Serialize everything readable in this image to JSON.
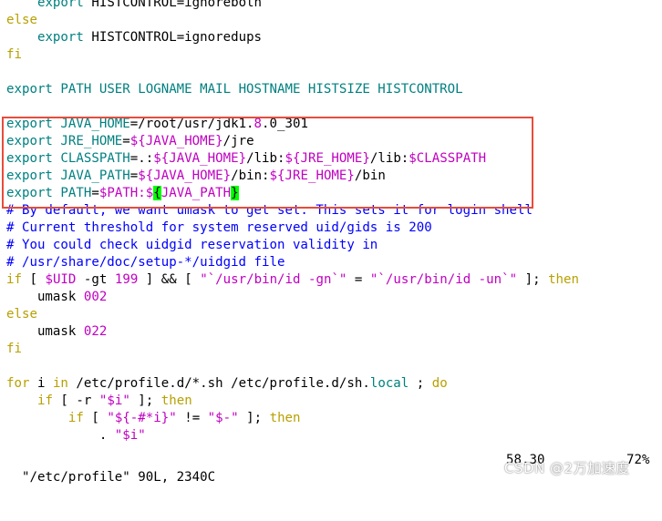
{
  "colors": {
    "keyword": "#b8a000",
    "command": "#008080",
    "variable": "#c000c0",
    "comment": "#0000ff",
    "cursor_bg": "#00ff00",
    "highlight_border": "#e74c3c",
    "background": "#ffffff"
  },
  "editor": {
    "lines": [
      [
        {
          "t": "    ",
          "c": ""
        },
        {
          "t": "export",
          "c": "cmd"
        },
        {
          "t": " HISTCONTROL=ignoreboth",
          "c": ""
        }
      ],
      [
        {
          "t": "else",
          "c": "kw"
        }
      ],
      [
        {
          "t": "    ",
          "c": ""
        },
        {
          "t": "export",
          "c": "cmd"
        },
        {
          "t": " HISTCONTROL=ignoredups",
          "c": ""
        }
      ],
      [
        {
          "t": "fi",
          "c": "kw"
        }
      ],
      [
        {
          "t": "",
          "c": ""
        }
      ],
      [
        {
          "t": "export",
          "c": "cmd"
        },
        {
          "t": " PATH USER LOGNAME MAIL HOSTNAME HISTSIZE HISTCONTROL",
          "c": "cmd"
        }
      ],
      [
        {
          "t": "",
          "c": ""
        }
      ],
      [
        {
          "t": "export",
          "c": "cmd"
        },
        {
          "t": " JAVA_HOME",
          "c": "cmd"
        },
        {
          "t": "=/root/usr/jdk1.",
          "c": ""
        },
        {
          "t": "8",
          "c": "num"
        },
        {
          "t": ".0_301",
          "c": ""
        }
      ],
      [
        {
          "t": "export",
          "c": "cmd"
        },
        {
          "t": " JRE_HOME",
          "c": "cmd"
        },
        {
          "t": "=",
          "c": ""
        },
        {
          "t": "${JAVA_HOME}",
          "c": "var"
        },
        {
          "t": "/jre",
          "c": ""
        }
      ],
      [
        {
          "t": "export",
          "c": "cmd"
        },
        {
          "t": " CLASSPATH",
          "c": "cmd"
        },
        {
          "t": "=.:",
          "c": ""
        },
        {
          "t": "${JAVA_HOME}",
          "c": "var"
        },
        {
          "t": "/lib:",
          "c": ""
        },
        {
          "t": "${JRE_HOME}",
          "c": "var"
        },
        {
          "t": "/lib:",
          "c": ""
        },
        {
          "t": "$CLASSPATH",
          "c": "var"
        }
      ],
      [
        {
          "t": "export",
          "c": "cmd"
        },
        {
          "t": " JAVA_PATH",
          "c": "cmd"
        },
        {
          "t": "=",
          "c": ""
        },
        {
          "t": "${JAVA_HOME}",
          "c": "var"
        },
        {
          "t": "/bin:",
          "c": ""
        },
        {
          "t": "${JRE_HOME}",
          "c": "var"
        },
        {
          "t": "/bin",
          "c": ""
        }
      ],
      [
        {
          "t": "export",
          "c": "cmd"
        },
        {
          "t": " PATH",
          "c": "cmd"
        },
        {
          "t": "=",
          "c": ""
        },
        {
          "t": "$PATH",
          "c": "var"
        },
        {
          "t": ":$",
          "c": "var"
        },
        {
          "t": "{",
          "c": "cursor"
        },
        {
          "t": "JAVA_PATH",
          "c": "var"
        },
        {
          "t": "}",
          "c": "cursor"
        }
      ],
      [
        {
          "t": "# By default, we want umask to get set. This sets it for login shell",
          "c": "com"
        }
      ],
      [
        {
          "t": "# Current threshold for system reserved uid/gids is 200",
          "c": "com"
        }
      ],
      [
        {
          "t": "# You could check uidgid reservation validity in",
          "c": "com"
        }
      ],
      [
        {
          "t": "# /usr/share/doc/setup-*/uidgid file",
          "c": "com"
        }
      ],
      [
        {
          "t": "if",
          "c": "kw"
        },
        {
          "t": " [ ",
          "c": ""
        },
        {
          "t": "$UID",
          "c": "var"
        },
        {
          "t": " -gt ",
          "c": ""
        },
        {
          "t": "199",
          "c": "num"
        },
        {
          "t": " ] && [ ",
          "c": ""
        },
        {
          "t": "\"`/usr/bin/id -gn`\"",
          "c": "str"
        },
        {
          "t": " = ",
          "c": ""
        },
        {
          "t": "\"`/usr/bin/id -un`\"",
          "c": "str"
        },
        {
          "t": " ]; ",
          "c": ""
        },
        {
          "t": "then",
          "c": "kw"
        }
      ],
      [
        {
          "t": "    umask ",
          "c": ""
        },
        {
          "t": "002",
          "c": "num"
        }
      ],
      [
        {
          "t": "else",
          "c": "kw"
        }
      ],
      [
        {
          "t": "    umask ",
          "c": ""
        },
        {
          "t": "022",
          "c": "num"
        }
      ],
      [
        {
          "t": "fi",
          "c": "kw"
        }
      ],
      [
        {
          "t": "",
          "c": ""
        }
      ],
      [
        {
          "t": "for",
          "c": "kw"
        },
        {
          "t": " i ",
          "c": ""
        },
        {
          "t": "in",
          "c": "kw"
        },
        {
          "t": " /etc/profile.d/*.sh /etc/profile.d/sh.",
          "c": ""
        },
        {
          "t": "local",
          "c": "cmd"
        },
        {
          "t": " ; ",
          "c": ""
        },
        {
          "t": "do",
          "c": "kw"
        }
      ],
      [
        {
          "t": "    ",
          "c": ""
        },
        {
          "t": "if",
          "c": "kw"
        },
        {
          "t": " [ -r ",
          "c": ""
        },
        {
          "t": "\"$i\"",
          "c": "str"
        },
        {
          "t": " ]; ",
          "c": ""
        },
        {
          "t": "then",
          "c": "kw"
        }
      ],
      [
        {
          "t": "        ",
          "c": ""
        },
        {
          "t": "if",
          "c": "kw"
        },
        {
          "t": " [ ",
          "c": ""
        },
        {
          "t": "\"${-#*i}\"",
          "c": "str"
        },
        {
          "t": " != ",
          "c": ""
        },
        {
          "t": "\"$-\"",
          "c": "str"
        },
        {
          "t": " ]; ",
          "c": ""
        },
        {
          "t": "then",
          "c": "kw"
        }
      ],
      [
        {
          "t": "            . ",
          "c": ""
        },
        {
          "t": "\"$i\"",
          "c": "str"
        }
      ]
    ]
  },
  "statusbar": {
    "file_info": "\"/etc/profile\" 90L, 2340C",
    "position": "58,30",
    "percent": "72%"
  },
  "watermark": "CSDN @2万加速度"
}
